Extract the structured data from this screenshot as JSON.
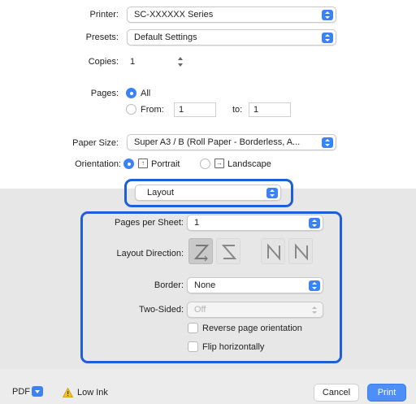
{
  "printer": {
    "label": "Printer:",
    "value": "SC-XXXXXX Series"
  },
  "presets": {
    "label": "Presets:",
    "value": "Default Settings"
  },
  "copies": {
    "label": "Copies:",
    "value": "1"
  },
  "pages": {
    "label": "Pages:",
    "all_label": "All",
    "from_label": "From:",
    "from_value": "1",
    "to_label": "to:",
    "to_value": "1"
  },
  "paper_size": {
    "label": "Paper Size:",
    "value": "Super A3 / B (Roll Paper - Borderless, A..."
  },
  "orientation": {
    "label": "Orientation:",
    "portrait_label": "Portrait",
    "landscape_label": "Landscape"
  },
  "section_popup": {
    "value": "Layout"
  },
  "layout": {
    "pages_per_sheet_label": "Pages per Sheet:",
    "pages_per_sheet_value": "1",
    "layout_direction_label": "Layout Direction:",
    "border_label": "Border:",
    "border_value": "None",
    "two_sided_label": "Two-Sided:",
    "two_sided_value": "Off",
    "reverse_label": "Reverse page orientation",
    "flip_label": "Flip horizontally"
  },
  "footer": {
    "pdf_label": "PDF",
    "warning_label": "Low Ink",
    "cancel_label": "Cancel",
    "print_label": "Print"
  },
  "colors": {
    "accent": "#3b82f6",
    "highlight": "#1f5fd6"
  }
}
